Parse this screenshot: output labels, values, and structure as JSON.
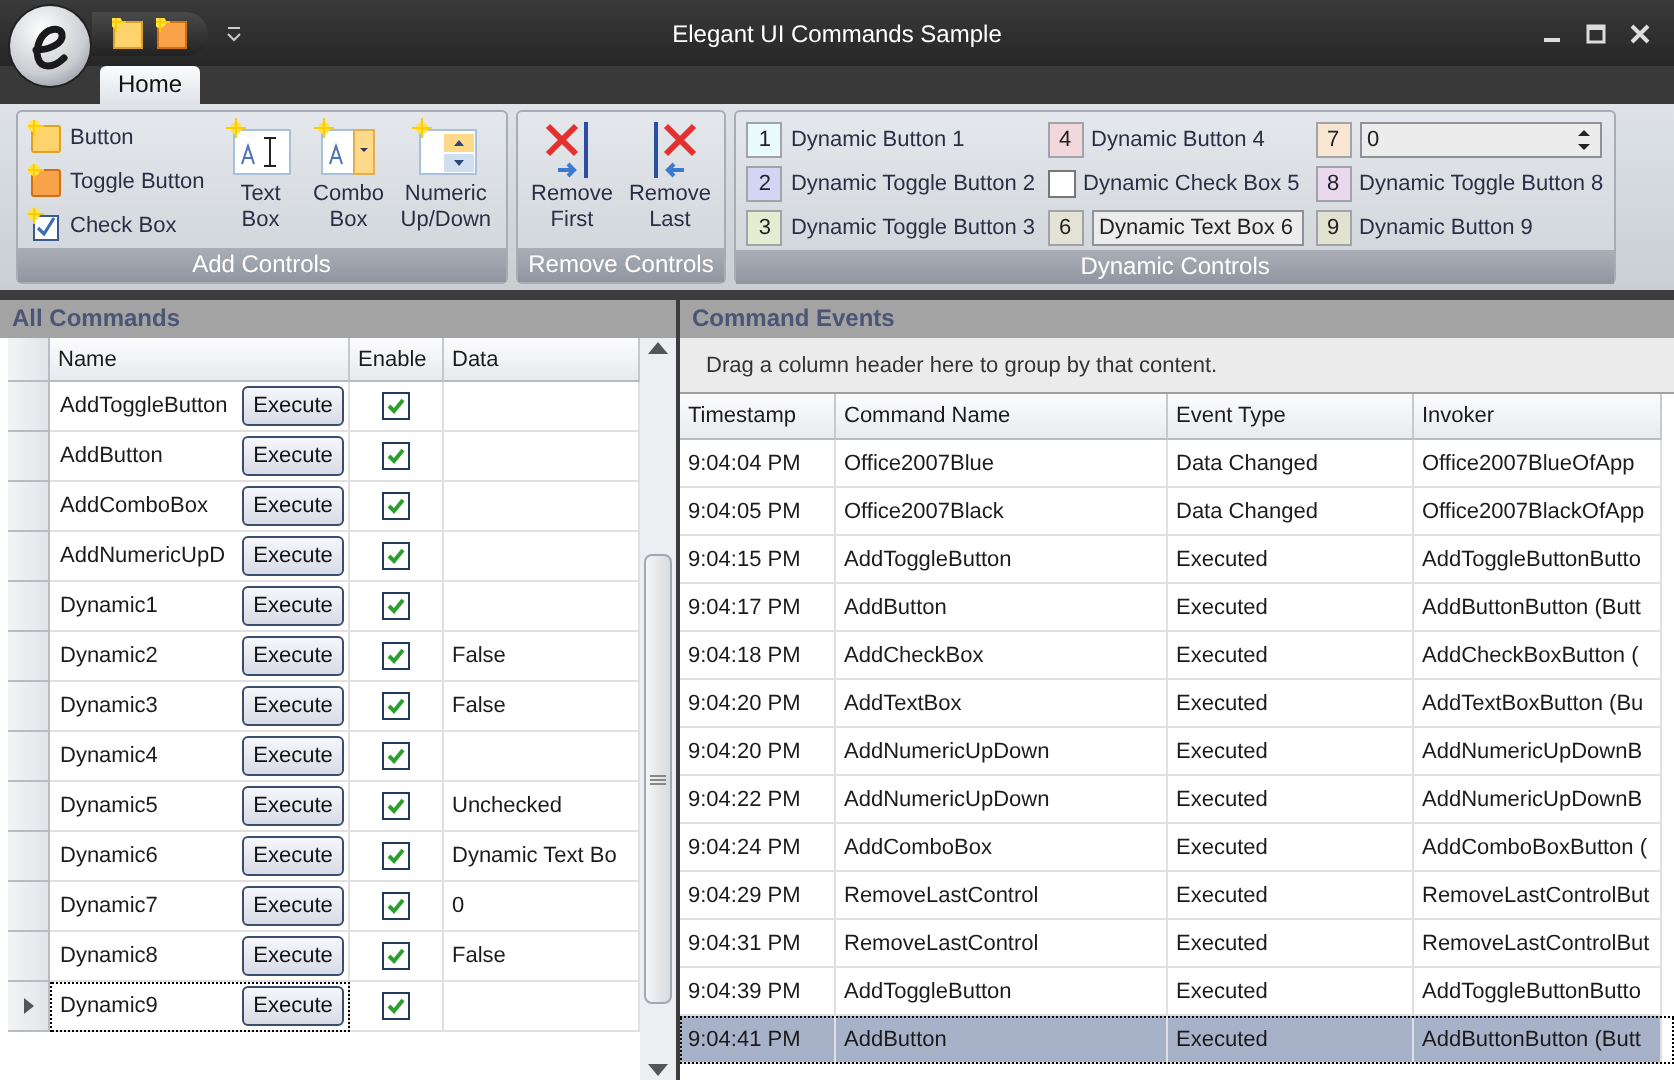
{
  "window": {
    "title": "Elegant UI Commands Sample"
  },
  "tabs": [
    {
      "label": "Home",
      "selected": true
    }
  ],
  "ribbon_groups": [
    {
      "title": "Add Controls",
      "small_items": [
        {
          "kind": "button",
          "label": "Button"
        },
        {
          "kind": "toggle",
          "label": "Toggle Button"
        },
        {
          "kind": "checkbox",
          "label": "Check Box"
        }
      ],
      "large_items": [
        {
          "kind": "textbox",
          "label": "Text Box"
        },
        {
          "kind": "combobox",
          "label": "Combo Box"
        },
        {
          "kind": "numeric",
          "label": "Numeric Up/Down"
        }
      ]
    },
    {
      "title": "Remove Controls",
      "large_items": [
        {
          "kind": "remove-first",
          "label": "Remove First"
        },
        {
          "kind": "remove-last",
          "label": "Remove Last"
        }
      ]
    }
  ],
  "dynamic_controls": {
    "title": "Dynamic Controls",
    "items": [
      {
        "kind": "button",
        "badge": "1",
        "color": "#e8fafa",
        "label": "Dynamic Button 1"
      },
      {
        "kind": "button",
        "badge": "4",
        "color": "#f2d8dc",
        "label": "Dynamic Button 4"
      },
      {
        "kind": "numeric",
        "badge": "7",
        "color": "#f8e6d2",
        "value": "0"
      },
      {
        "kind": "toggle",
        "badge": "2",
        "color": "#d4d4f4",
        "label": "Dynamic Toggle Button 2"
      },
      {
        "kind": "checkbox",
        "label": "Dynamic Check Box 5",
        "checked": false
      },
      {
        "kind": "toggle",
        "badge": "8",
        "color": "#ead8ee",
        "label": "Dynamic Toggle Button 8"
      },
      {
        "kind": "toggle",
        "badge": "3",
        "color": "#e4ecd2",
        "label": "Dynamic Toggle Button 3"
      },
      {
        "kind": "textbox",
        "badge": "6",
        "color": "#e4e2d4",
        "value": "Dynamic Text Box 6"
      },
      {
        "kind": "button",
        "badge": "9",
        "color": "#e2e2d0",
        "label": "Dynamic Button 9"
      }
    ]
  },
  "all_commands": {
    "title": "All Commands",
    "columns": [
      "Name",
      "Enable",
      "Data"
    ],
    "rows": [
      {
        "name": "AddToggleButton",
        "button": "Execute",
        "enabled": true,
        "selected": false
      },
      {
        "name": "AddButton",
        "button": "Execute",
        "enabled": true,
        "selected": false
      },
      {
        "name": "AddComboBox",
        "button": "Execute",
        "enabled": true,
        "selected": false
      },
      {
        "name": "AddNumericUpD",
        "button": "Execute",
        "enabled": true,
        "selected": false
      },
      {
        "name": "Dynamic1",
        "button": "Execute",
        "enabled": true,
        "selected": false
      },
      {
        "name": "Dynamic2",
        "button": "Execute",
        "enabled": true,
        "data": "False",
        "selected": false
      },
      {
        "name": "Dynamic3",
        "button": "Execute",
        "enabled": true,
        "data": "False",
        "selected": false
      },
      {
        "name": "Dynamic4",
        "button": "Execute",
        "enabled": true,
        "selected": false
      },
      {
        "name": "Dynamic5",
        "button": "Execute",
        "enabled": true,
        "data": "Unchecked",
        "selected": false
      },
      {
        "name": "Dynamic6",
        "button": "Execute",
        "enabled": true,
        "data": "Dynamic Text Bo",
        "selected": false
      },
      {
        "name": "Dynamic7",
        "button": "Execute",
        "enabled": true,
        "data": "0",
        "selected": false
      },
      {
        "name": "Dynamic8",
        "button": "Execute",
        "enabled": true,
        "data": "False",
        "selected": false
      },
      {
        "name": "Dynamic9",
        "button": "Execute",
        "enabled": true,
        "selected": true
      }
    ]
  },
  "command_events": {
    "title": "Command Events",
    "group_hint": "Drag a column header here to group by that content.",
    "columns": [
      "Timestamp",
      "Command Name",
      "Event Type",
      "Invoker"
    ],
    "rows": [
      {
        "cells": [
          "9:04:04 PM",
          "Office2007Blue",
          "Data Changed",
          "Office2007BlueOfApp"
        ],
        "selected": false
      },
      {
        "cells": [
          "9:04:05 PM",
          "Office2007Black",
          "Data Changed",
          "Office2007BlackOfApp"
        ],
        "selected": false
      },
      {
        "cells": [
          "9:04:15 PM",
          "AddToggleButton",
          "Executed",
          "AddToggleButtonButto"
        ],
        "selected": false
      },
      {
        "cells": [
          "9:04:17 PM",
          "AddButton",
          "Executed",
          "AddButtonButton (Butt"
        ],
        "selected": false
      },
      {
        "cells": [
          "9:04:18 PM",
          "AddCheckBox",
          "Executed",
          "AddCheckBoxButton ("
        ],
        "selected": false
      },
      {
        "cells": [
          "9:04:20 PM",
          "AddTextBox",
          "Executed",
          "AddTextBoxButton (Bu"
        ],
        "selected": false
      },
      {
        "cells": [
          "9:04:20 PM",
          "AddNumericUpDown",
          "Executed",
          "AddNumericUpDownB"
        ],
        "selected": false
      },
      {
        "cells": [
          "9:04:22 PM",
          "AddNumericUpDown",
          "Executed",
          "AddNumericUpDownB"
        ],
        "selected": false
      },
      {
        "cells": [
          "9:04:24 PM",
          "AddComboBox",
          "Executed",
          "AddComboBoxButton ("
        ],
        "selected": false
      },
      {
        "cells": [
          "9:04:29 PM",
          "RemoveLastControl",
          "Executed",
          "RemoveLastControlBut"
        ],
        "selected": false
      },
      {
        "cells": [
          "9:04:31 PM",
          "RemoveLastControl",
          "Executed",
          "RemoveLastControlBut"
        ],
        "selected": false
      },
      {
        "cells": [
          "9:04:39 PM",
          "AddToggleButton",
          "Executed",
          "AddToggleButtonButto"
        ],
        "selected": false
      },
      {
        "cells": [
          "9:04:41 PM",
          "AddButton",
          "Executed",
          "AddButtonButton (Butt"
        ],
        "selected": true
      }
    ]
  }
}
